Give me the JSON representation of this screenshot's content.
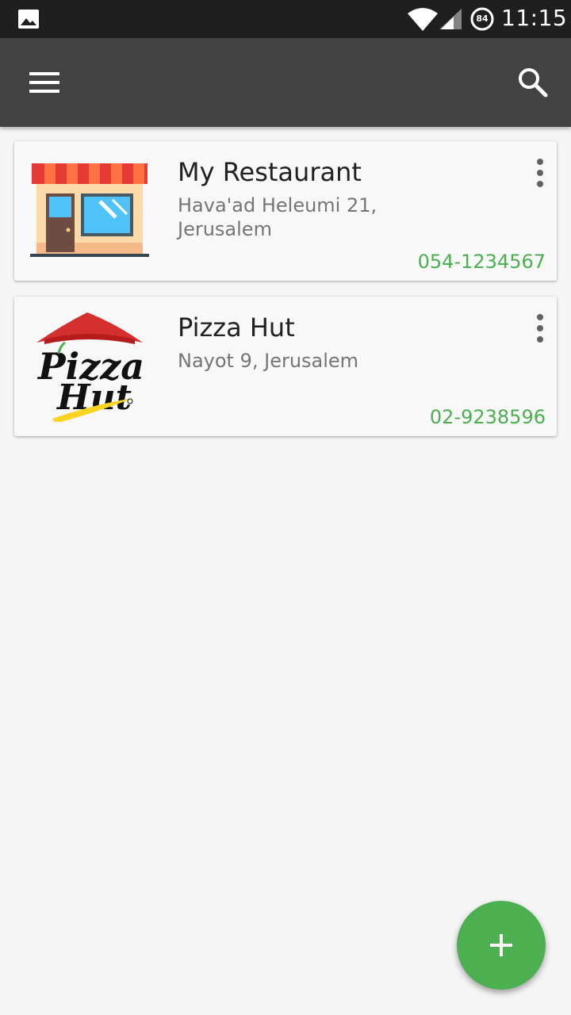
{
  "status_bar": {
    "time": "11:15",
    "battery": "84",
    "icons": [
      "image-notification-icon",
      "wifi-icon",
      "signal-icon",
      "battery-icon"
    ]
  },
  "app_bar": {
    "icons": [
      "menu-icon",
      "search-icon"
    ]
  },
  "restaurants": [
    {
      "name": "My Restaurant",
      "address": "Hava'ad Heleumi 21, Jerusalem",
      "phone": "054-1234567",
      "icon": "storefront-icon"
    },
    {
      "name": "Pizza Hut",
      "address": "Nayot 9, Jerusalem",
      "phone": "02-9238596",
      "icon": "pizza-hut-logo"
    }
  ],
  "fab": {
    "icon": "plus-icon"
  },
  "colors": {
    "status_bar": "#1f1f1f",
    "app_bar": "#424242",
    "accent": "#4caf50",
    "background": "#f5f5f5"
  }
}
